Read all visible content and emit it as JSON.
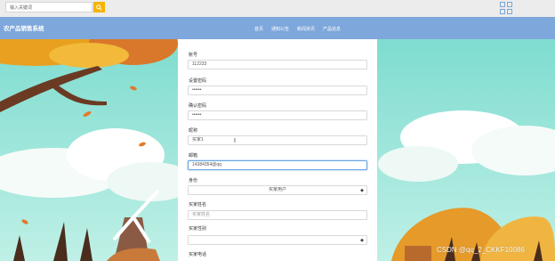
{
  "search": {
    "placeholder": "输入关键词"
  },
  "header": {
    "brand": "农产品销售系统"
  },
  "nav": {
    "items": [
      "首页",
      "通知公告",
      "新闻资讯",
      "产品信息"
    ]
  },
  "form": {
    "account": {
      "label": "账号",
      "value": "112233"
    },
    "password": {
      "label": "设置密码",
      "value": "••••••"
    },
    "confirm": {
      "label": "确认密码",
      "value": "••••••"
    },
    "nickname": {
      "label": "昵称",
      "value": "买家1"
    },
    "email": {
      "label": "邮箱",
      "value": "14384354@qq"
    },
    "role": {
      "label": "身份",
      "value": "买家用户"
    },
    "buyer_name": {
      "label": "买家姓名",
      "placeholder": "买家姓名"
    },
    "buyer_gender": {
      "label": "买家性别",
      "value": ""
    },
    "buyer_phone": {
      "label": "买家电话"
    }
  },
  "watermark": "CSDN @qq_2_CKKF10086",
  "colors": {
    "nav": "#7ea7db",
    "search_button": "#f4b400",
    "sky": "#8fdfd4"
  },
  "icons": [
    "search-icon",
    "grid-icon",
    "caret-icon"
  ]
}
